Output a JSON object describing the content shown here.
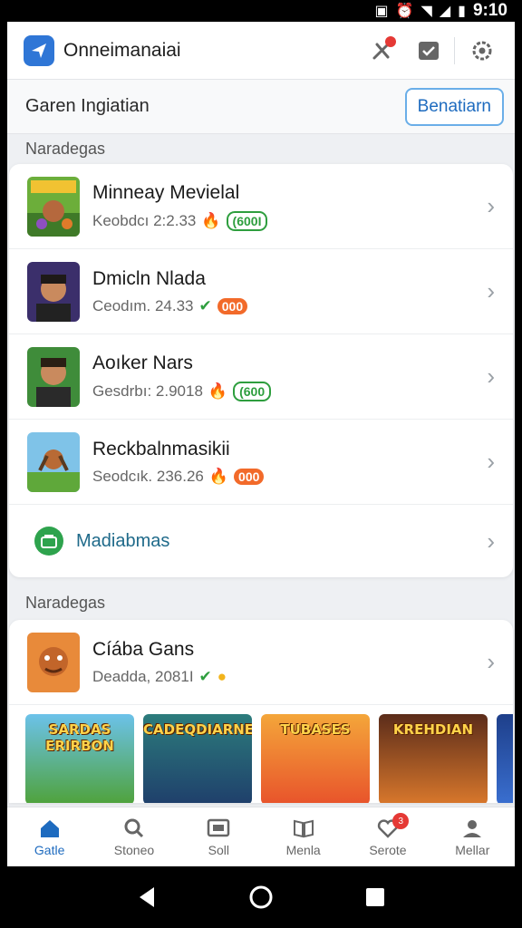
{
  "status_bar": {
    "time": "9:10"
  },
  "header": {
    "app_title": "Onneimanaiai",
    "accent": "#2f76d6"
  },
  "subbar": {
    "title": "Garen Ingiatian",
    "button_label": "Benatiarn"
  },
  "sections": [
    {
      "label": "Naradegas",
      "items": [
        {
          "title": "Minneay Mevielal",
          "sub": "Keobdcı 2:2.33",
          "badge": "(600I",
          "badge_style": "green",
          "icon": "fire-icon"
        },
        {
          "title": "Dmicln Nlada",
          "sub": "Ceodım. 24.33",
          "badge": "000",
          "badge_style": "orange",
          "icon": "check-circle-icon"
        },
        {
          "title": "Aoıker Nars",
          "sub": "Gesdrbı: 2.9018",
          "badge": "(600",
          "badge_style": "green",
          "icon": "fire-icon"
        },
        {
          "title": "Reckbalnmasikii",
          "sub": "Seodcık. 236.26",
          "badge": "000",
          "badge_style": "orange",
          "icon": "fire-icon"
        }
      ],
      "more_label": "Madiabmas"
    },
    {
      "label": "Naradegas",
      "items": [
        {
          "title": "Cíába Gans",
          "sub": "Deadda, 2081I",
          "icon": "coin-icon"
        }
      ]
    }
  ],
  "banners": [
    {
      "text": "SARDAS ERIRBON",
      "colors": [
        "#4fa23a",
        "#2f6fbf"
      ]
    },
    {
      "text": "CADEQDIARNEA",
      "colors": [
        "#2c7c7c",
        "#1f3f6b"
      ]
    },
    {
      "text": "TUBASES",
      "colors": [
        "#e8532b",
        "#f4a63a"
      ]
    },
    {
      "text": "KREHDIAN",
      "colors": [
        "#5b2c1a",
        "#d9782c"
      ]
    }
  ],
  "bottom_nav": [
    {
      "label": "Gatle",
      "icon": "home-icon",
      "active": true
    },
    {
      "label": "Stoneo",
      "icon": "search-icon",
      "active": false
    },
    {
      "label": "Soll",
      "icon": "tv-icon",
      "active": false
    },
    {
      "label": "Menla",
      "icon": "book-icon",
      "active": false
    },
    {
      "label": "Serote",
      "icon": "heart-icon",
      "active": false,
      "badge": "3"
    },
    {
      "label": "Mellar",
      "icon": "person-icon",
      "active": false
    }
  ]
}
